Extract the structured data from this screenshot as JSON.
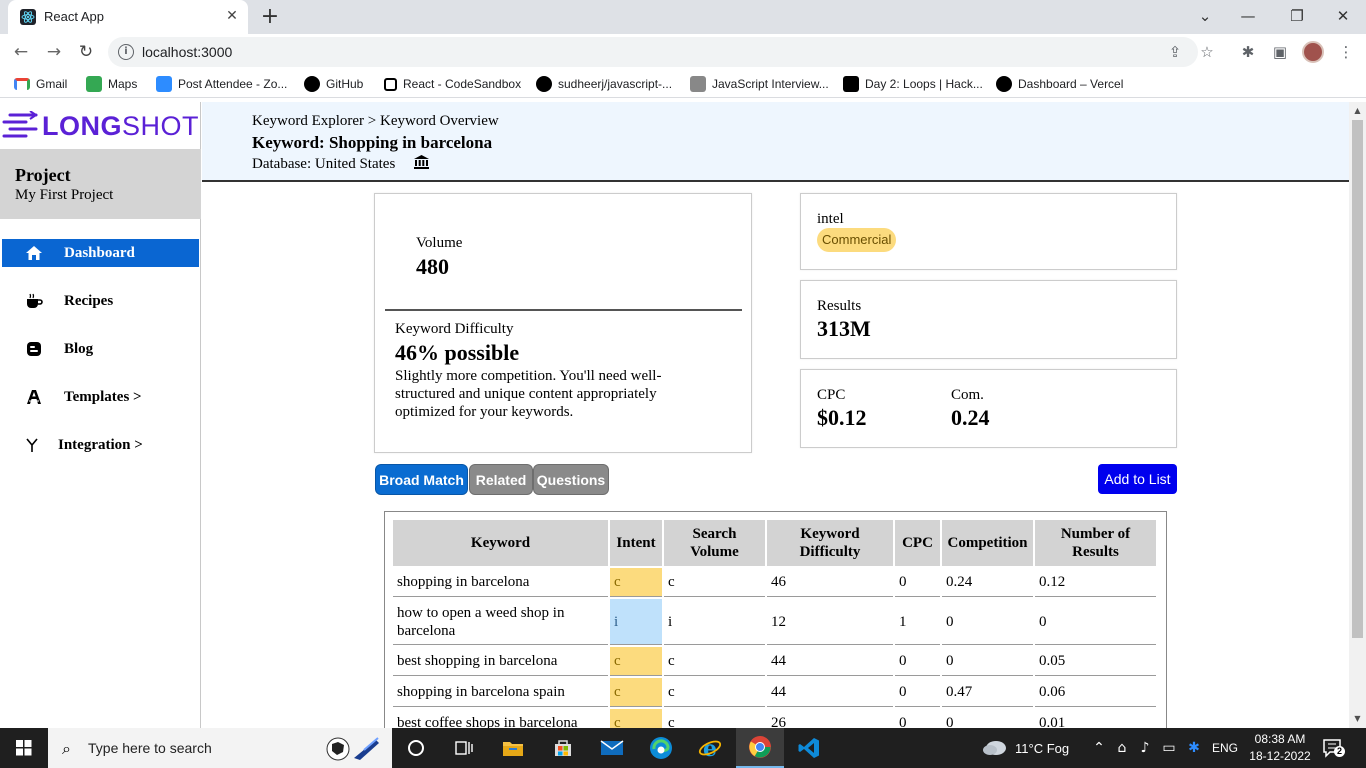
{
  "browser": {
    "tab_title": "React App",
    "tab_close": "✕",
    "new_tab": "+",
    "url": "localhost:3000",
    "controls": {
      "tab_search": "⌄",
      "minimize": "—",
      "restore": "❐",
      "close": "✕"
    },
    "bookmarks": [
      {
        "label": "Gmail",
        "icon": "gmail-icon",
        "color": "#ea4335"
      },
      {
        "label": "Maps",
        "icon": "maps-icon",
        "color": "#34a853"
      },
      {
        "label": "Post Attendee - Zo...",
        "icon": "zoom-icon",
        "color": "#2d8cff"
      },
      {
        "label": "GitHub",
        "icon": "github-icon",
        "color": "#000000"
      },
      {
        "label": "React - CodeSandbox",
        "icon": "codesandbox-icon",
        "color": "#000000"
      },
      {
        "label": "sudheerj/javascript-...",
        "icon": "github-icon",
        "color": "#000000"
      },
      {
        "label": "JavaScript Interview...",
        "icon": "stack-icon",
        "color": "#888888"
      },
      {
        "label": "Day 2: Loops | Hack...",
        "icon": "hackerrank-icon",
        "color": "#000000"
      },
      {
        "label": "Dashboard – Vercel",
        "icon": "vercel-icon",
        "color": "#000000"
      }
    ]
  },
  "sidebar": {
    "logo_bold": "LONG",
    "logo_light": "SHOT",
    "project_title": "Project",
    "project_name": "My First Project",
    "items": [
      {
        "label": "Dashboard",
        "icon": "home-icon",
        "active": true
      },
      {
        "label": "Recipes",
        "icon": "coffee-icon",
        "active": false
      },
      {
        "label": "Blog",
        "icon": "blogger-icon",
        "active": false
      },
      {
        "label": "Templates >",
        "icon": "templates-icon",
        "active": false
      },
      {
        "label": "Integration >",
        "icon": "integration-icon",
        "active": false
      }
    ]
  },
  "header": {
    "breadcrumb": "Keyword Explorer > Keyword Overview",
    "keyword_title": "Keyword: Shopping in barcelona",
    "database": "Database: United States"
  },
  "cards": {
    "volume_label": "Volume",
    "volume_value": "480",
    "kd_label": "Keyword Difficulty",
    "kd_value": "46% possible",
    "kd_desc": "Slightly more competition. You'll need well-structured and unique content appropriately optimized for your keywords.",
    "intent_label": "intel",
    "intent_badge": "Commercial",
    "results_label": "Results",
    "results_value": "313M",
    "cpc_label": "CPC",
    "cpc_value": "$0.12",
    "com_label": "Com.",
    "com_value": "0.24"
  },
  "tabs": [
    {
      "label": "Broad Match",
      "active": true
    },
    {
      "label": "Related",
      "active": false
    },
    {
      "label": "Questions",
      "active": false
    }
  ],
  "add_to_list": "Add to List",
  "table": {
    "headers": [
      "Keyword",
      "Intent",
      "Search Volume",
      "Keyword Difficulty",
      "CPC",
      "Competition",
      "Number of Results"
    ],
    "rows": [
      {
        "keyword": "shopping in barcelona",
        "intent": "c",
        "volume": "c",
        "difficulty": "46",
        "cpc": "0",
        "competition": "0.24",
        "results": "0.12"
      },
      {
        "keyword": "how to open a weed shop in barcelona",
        "intent": "i",
        "volume": "i",
        "difficulty": "12",
        "cpc": "1",
        "competition": "0",
        "results": "0"
      },
      {
        "keyword": "best shopping in barcelona",
        "intent": "c",
        "volume": "c",
        "difficulty": "44",
        "cpc": "0",
        "competition": "0",
        "results": "0.05"
      },
      {
        "keyword": "shopping in barcelona spain",
        "intent": "c",
        "volume": "c",
        "difficulty": "44",
        "cpc": "0",
        "competition": "0.47",
        "results": "0.06"
      },
      {
        "keyword": "best coffee shops in barcelona",
        "intent": "c",
        "volume": "c",
        "difficulty": "26",
        "cpc": "0",
        "competition": "0",
        "results": "0.01"
      }
    ]
  },
  "taskbar": {
    "search_placeholder": "Type here to search",
    "weather": "11°C  Fog",
    "lang": "ENG",
    "time": "08:38 AM",
    "date": "18-12-2022",
    "notifications": "2"
  }
}
